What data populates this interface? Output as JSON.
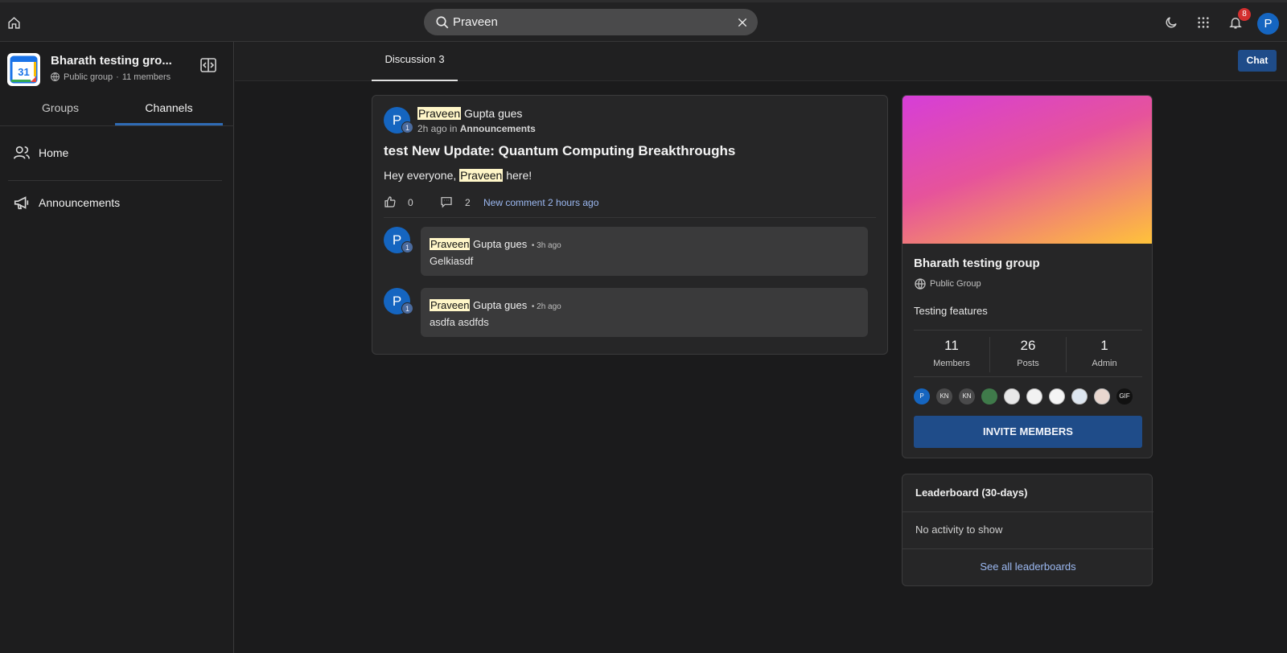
{
  "topbar": {
    "search_value": "Praveen",
    "notification_count": "8",
    "avatar_initial": "P"
  },
  "sidebar": {
    "group_name": "Bharath testing gro...",
    "group_privacy": "Public group",
    "group_members": "11 members",
    "logo_text": "31",
    "tabs": [
      {
        "label": "Groups"
      },
      {
        "label": "Channels"
      }
    ],
    "nav": [
      {
        "label": "Home"
      },
      {
        "label": "Announcements"
      }
    ]
  },
  "content": {
    "tab_label": "Discussion",
    "tab_count": "3",
    "chat_label": "Chat"
  },
  "post": {
    "avatar_initial": "P",
    "avatar_badge": "1",
    "author_highlight": "Praveen",
    "author_rest": " Gupta gues",
    "time": "2h ago",
    "in_word": "in",
    "channel": "Announcements",
    "title": "test New Update: Quantum Computing Breakthroughs",
    "body_pre": "Hey everyone, ",
    "body_highlight": "Praveen",
    "body_post": " here!",
    "likes": "0",
    "comments": "2",
    "new_comment": "New comment 2 hours ago"
  },
  "comments": [
    {
      "avatar_initial": "P",
      "avatar_badge": "1",
      "author_highlight": "Praveen",
      "author_rest": " Gupta gues",
      "ago": "• 3h ago",
      "text": "Gelkiasdf"
    },
    {
      "avatar_initial": "P",
      "avatar_badge": "1",
      "author_highlight": "Praveen",
      "author_rest": " Gupta gues",
      "ago": "• 2h ago",
      "text": "asdfa asdfds"
    }
  ],
  "group_card": {
    "name": "Bharath testing group",
    "type": "Public Group",
    "description": "Testing features",
    "stats": [
      {
        "value": "11",
        "label": "Members"
      },
      {
        "value": "26",
        "label": "Posts"
      },
      {
        "value": "1",
        "label": "Admin"
      }
    ],
    "member_avatars": [
      {
        "text": "P",
        "color": "#1565c0"
      },
      {
        "text": "KN",
        "color": "#4a4a4b"
      },
      {
        "text": "KN",
        "color": "#4a4a4b"
      },
      {
        "text": "",
        "color": "#3f7a4a"
      },
      {
        "text": "",
        "color": "#e8e8e8"
      },
      {
        "text": "",
        "color": "#f2f2f2"
      },
      {
        "text": "",
        "color": "#f5f5f5"
      },
      {
        "text": "",
        "color": "#dde6f0"
      },
      {
        "text": "",
        "color": "#e9d7cf"
      },
      {
        "text": "GIF",
        "color": "#111111"
      }
    ],
    "invite_label": "INVITE MEMBERS"
  },
  "leaderboard": {
    "title": "Leaderboard (30-days)",
    "empty": "No activity to show",
    "link": "See all leaderboards"
  },
  "colors": {
    "accent": "#1f4c89",
    "link": "#9cb9f2",
    "highlight": "#fff6c8",
    "badge": "#d32f2f"
  }
}
